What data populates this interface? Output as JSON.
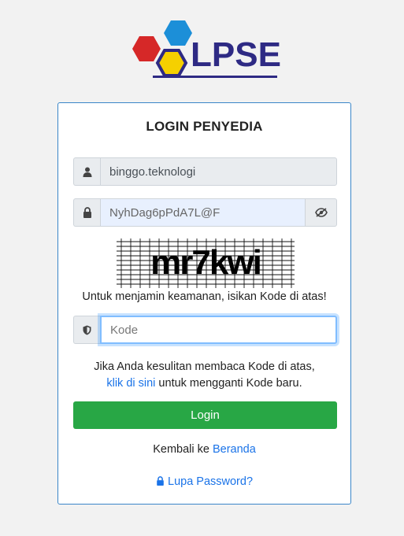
{
  "logo": {
    "text": "LPSE"
  },
  "login": {
    "title": "LOGIN PENYEDIA",
    "username_value": "binggo.teknologi",
    "password_value": "NyhDag6pPdA7L@F",
    "captcha_text": "mr7kwi",
    "captcha_note": "Untuk menjamin keamanan, isikan Kode di atas!",
    "code_placeholder": "Kode",
    "help_line1": "Jika Anda kesulitan membaca Kode di atas,",
    "help_link": "klik di sini",
    "help_line2_rest": " untuk mengganti Kode baru.",
    "login_button": "Login",
    "back_prefix": "Kembali ke ",
    "back_link": "Beranda",
    "forgot_link": "Lupa Password?"
  },
  "colors": {
    "primary_border": "#3a86c8",
    "button_green": "#28a745",
    "link_blue": "#1a73e8",
    "logo_blue": "#2e2a84",
    "logo_red": "#d62828",
    "logo_yellow": "#f5d000",
    "logo_cyan": "#1c8fd8"
  },
  "icons": {
    "username": "user-icon",
    "password": "lock-icon",
    "toggle": "eye-slash-icon",
    "code": "shield-icon",
    "forgot": "lock-icon"
  }
}
